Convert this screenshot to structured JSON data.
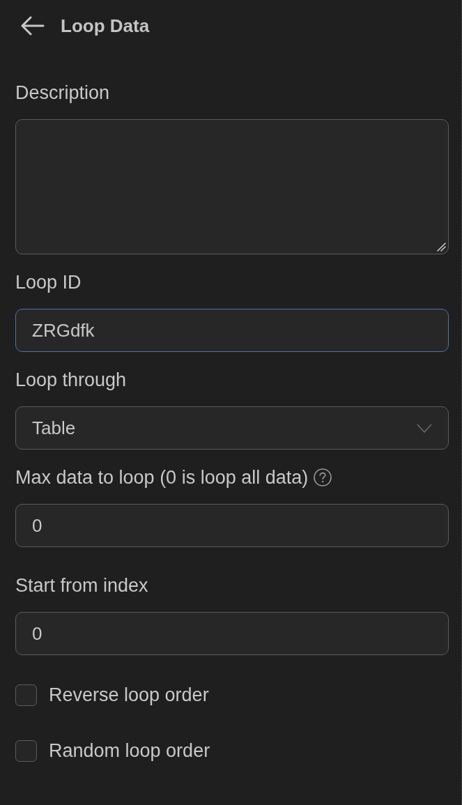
{
  "header": {
    "title": "Loop Data"
  },
  "fields": [
    {
      "kind": "textarea",
      "label": "Description",
      "focused": false
    },
    {
      "kind": "text",
      "label": "Loop ID",
      "value": "ZRGdfk",
      "focused": true
    },
    {
      "kind": "select",
      "label": "Loop through",
      "value": "Table",
      "focused": false
    },
    {
      "kind": "number",
      "label": "Max data to loop (0 is loop all data)",
      "help": true,
      "value": "0",
      "focused": false
    },
    {
      "kind": "number",
      "label": "Start from index",
      "value": "0",
      "focused": false
    }
  ],
  "checkboxes": [
    {
      "label": "Reverse loop order",
      "checked": false
    },
    {
      "label": "Random loop order",
      "checked": false
    }
  ]
}
